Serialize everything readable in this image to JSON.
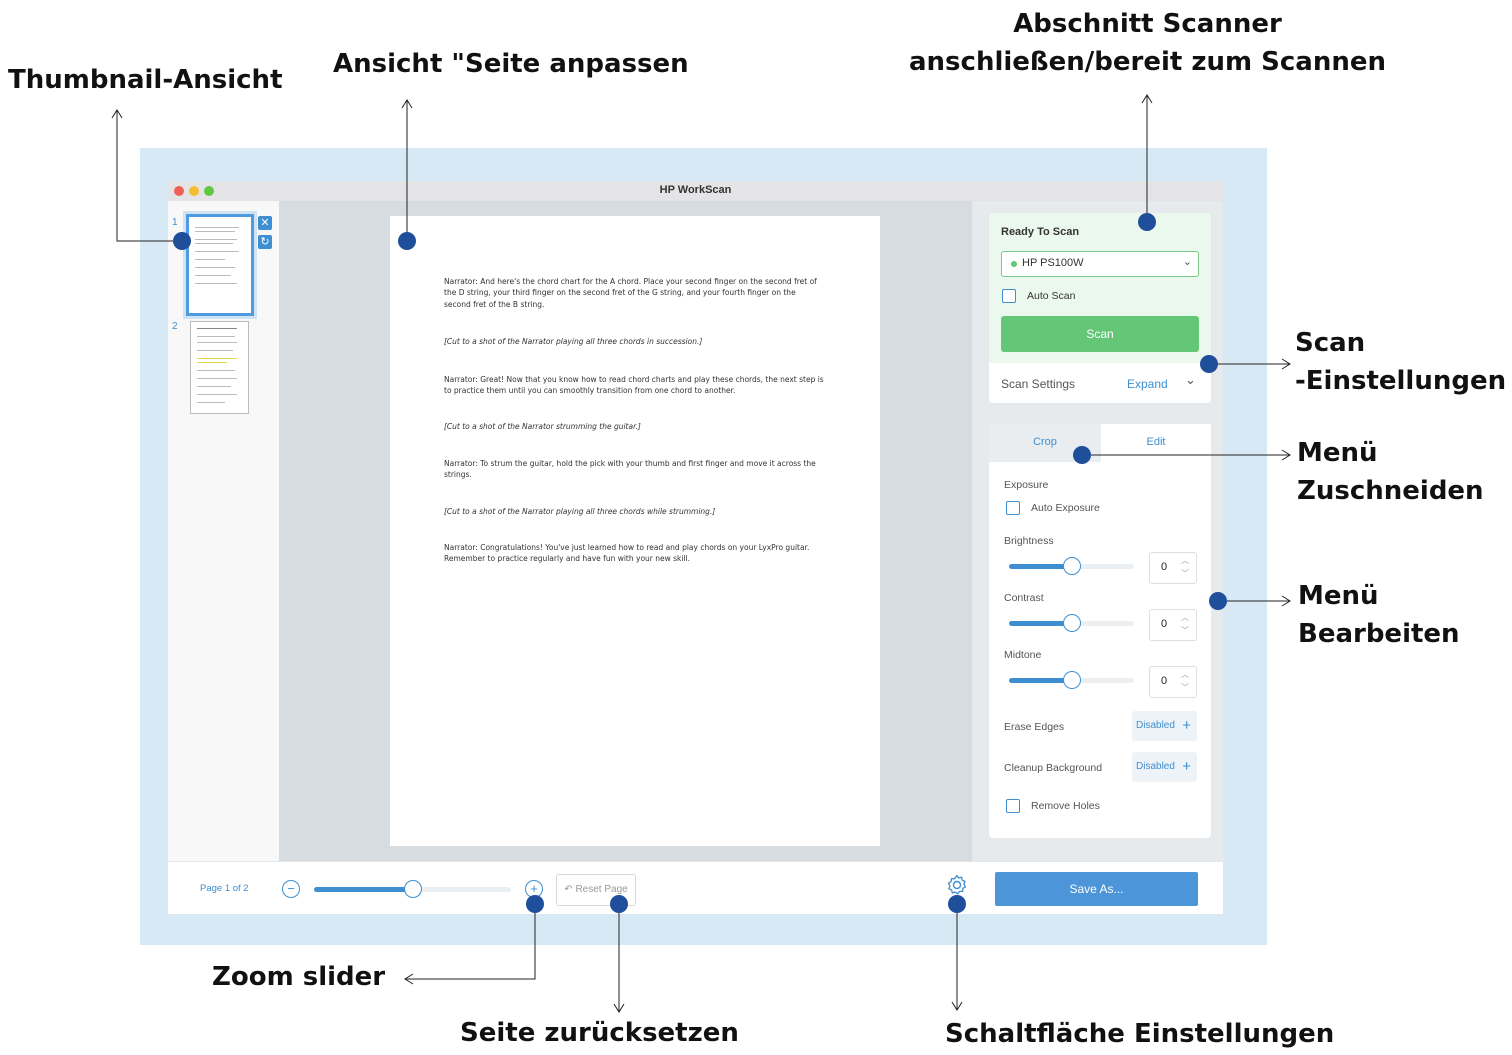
{
  "callouts": {
    "thumbnail_view": "Thumbnail-Ansicht",
    "fit_page_view": "Ansicht \"Seite anpassen",
    "scanner_section_line1": "Abschnitt Scanner",
    "scanner_section_line2": "anschließen/bereit zum Scannen",
    "scan_settings_line1": "Scan",
    "scan_settings_line2": "-Einstellungen",
    "crop_menu_line1": "Menü",
    "crop_menu_line2": "Zuschneiden",
    "edit_menu_line1": "Menü",
    "edit_menu_line2": "Bearbeiten",
    "zoom_slider": "Zoom slider",
    "reset_page": "Seite zurücksetzen",
    "settings_button": "Schaltfläche Einstellungen"
  },
  "window": {
    "title": "HP WorkScan",
    "traffic_colors": [
      "#ee5f57",
      "#f5bd30",
      "#5ec840"
    ]
  },
  "thumbnails": {
    "pages": [
      {
        "number": "1"
      },
      {
        "number": "2"
      }
    ],
    "delete_icon": "close-icon",
    "rotate_icon": "rotate-icon"
  },
  "document": {
    "paragraphs": [
      {
        "text": "Narrator: And here's the chord chart for the A chord. Place your second finger on the second fret of the D string, your third finger on the second fret of the G string, and your fourth finger on the second fret of the B string.",
        "italic": false
      },
      {
        "text": "[Cut to a shot of the Narrator playing all three chords in succession.]",
        "italic": true
      },
      {
        "text": "Narrator: Great! Now that you know how to read chord charts and play these chords, the next step is to practice them until you can smoothly transition from one chord to another.",
        "italic": false
      },
      {
        "text": "[Cut to a shot of the Narrator strumming the guitar.]",
        "italic": true
      },
      {
        "text": "Narrator: To strum the guitar, hold the pick with your thumb and first finger and move it across the strings.",
        "italic": false
      },
      {
        "text": "[Cut to a shot of the Narrator playing all three chords while strumming.]",
        "italic": true
      },
      {
        "text": "Narrator: Congratulations! You've just learned how to read and play chords on your LyxPro guitar. Remember to practice regularly and have fun with your new skill.",
        "italic": false
      }
    ]
  },
  "scanner": {
    "status": "Ready To Scan",
    "device": "HP PS100W",
    "device_status_color": "#64c777",
    "auto_scan_label": "Auto Scan",
    "auto_scan_checked": false,
    "scan_button": "Scan",
    "settings_label": "Scan Settings",
    "expand_label": "Expand"
  },
  "edit_panel": {
    "tabs": [
      "Crop",
      "Edit"
    ],
    "active_tab": "Edit",
    "exposure_label": "Exposure",
    "auto_exposure_label": "Auto Exposure",
    "auto_exposure_checked": false,
    "brightness": {
      "label": "Brightness",
      "value": "0",
      "level": 0.5
    },
    "contrast": {
      "label": "Contrast",
      "value": "0",
      "level": 0.5
    },
    "midtone": {
      "label": "Midtone",
      "value": "0",
      "level": 0.5
    },
    "erase_edges": {
      "label": "Erase Edges",
      "value": "Disabled"
    },
    "cleanup_background": {
      "label": "Cleanup Background",
      "value": "Disabled"
    },
    "remove_holes_label": "Remove Holes",
    "remove_holes_checked": false
  },
  "bottom_bar": {
    "page_indicator": "Page 1 of 2",
    "zoom_level": 0.5,
    "reset_label": "Reset Page",
    "save_label": "Save As...",
    "settings_icon": "gear-icon"
  },
  "accent_color": "#3d8fd1",
  "marker_color": "#1f4e9a"
}
